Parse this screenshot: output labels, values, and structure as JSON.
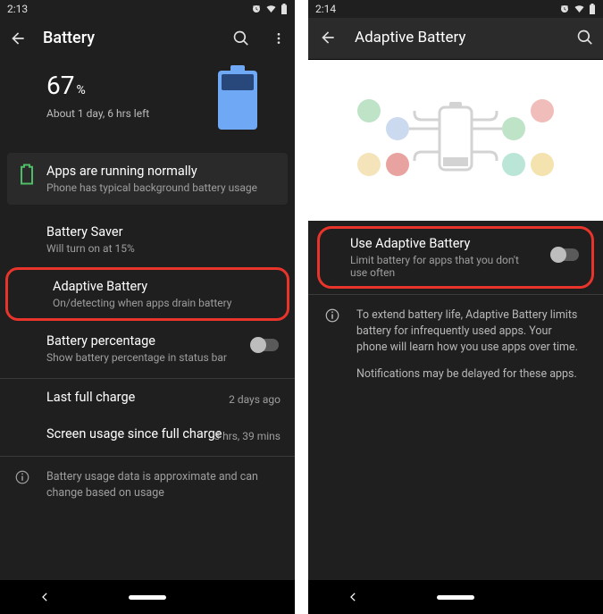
{
  "left": {
    "status": {
      "time": "2:13"
    },
    "appbar": {
      "title": "Battery"
    },
    "hero": {
      "percent": "67",
      "percent_sym": "%",
      "estimate": "About 1 day, 6 hrs left"
    },
    "card": {
      "title": "Apps are running normally",
      "sub": "Phone has typical background battery usage"
    },
    "items": {
      "saver": {
        "title": "Battery Saver",
        "sub": "Will turn on at 15%"
      },
      "adaptive": {
        "title": "Adaptive Battery",
        "sub": "On/detecting when apps drain battery"
      },
      "percent": {
        "title": "Battery percentage",
        "sub": "Show battery percentage in status bar"
      },
      "lastcharge": {
        "title": "Last full charge",
        "value": "2 days ago"
      },
      "screen": {
        "title": "Screen usage since full charge",
        "value": "5 hrs, 39 mins"
      }
    },
    "info": "Battery usage data is approximate and can change based on usage"
  },
  "right": {
    "status": {
      "time": "2:14"
    },
    "appbar": {
      "title": "Adaptive Battery"
    },
    "toggle": {
      "title": "Use Adaptive Battery",
      "sub": "Limit battery for apps that you don't use often"
    },
    "info1": "To extend battery life, Adaptive Battery limits battery for infrequently used apps. Your phone will learn how you use apps over time.",
    "info2": "Notifications may be delayed for these apps."
  }
}
